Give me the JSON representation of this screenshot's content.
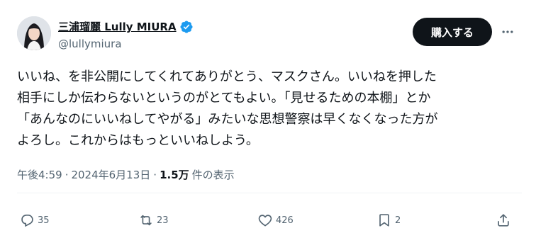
{
  "author": {
    "display_name": "三浦瑠麗 Lully MIURA",
    "handle": "@lullymiura",
    "verified_icon": "verified-badge-icon",
    "verified_color": "#1d9bf0"
  },
  "header": {
    "buy_label": "購入する",
    "more_icon": "more-horizontal-icon"
  },
  "tweet": {
    "lines": [
      "いいね、を非公開にしてくれてありがとう、マスクさん。いいねを押した",
      "相手にしか伝わらないというのがとてもよい。「見せるための本棚」とか",
      "「あんなのにいいねしてやがる」みたいな思想警察は早くなくなった方が",
      "よろし。これからはもっといいねしよう。"
    ]
  },
  "meta": {
    "time": "午後4:59",
    "separator": "·",
    "date": "2024年6月13日",
    "views_count": "1.5万",
    "views_label": "件の表示"
  },
  "actions": {
    "reply": {
      "icon": "reply-icon",
      "count": "35"
    },
    "retweet": {
      "icon": "retweet-icon",
      "count": "23"
    },
    "like": {
      "icon": "heart-icon",
      "count": "426"
    },
    "bookmark": {
      "icon": "bookmark-icon",
      "count": "2"
    },
    "share": {
      "icon": "share-icon"
    }
  }
}
